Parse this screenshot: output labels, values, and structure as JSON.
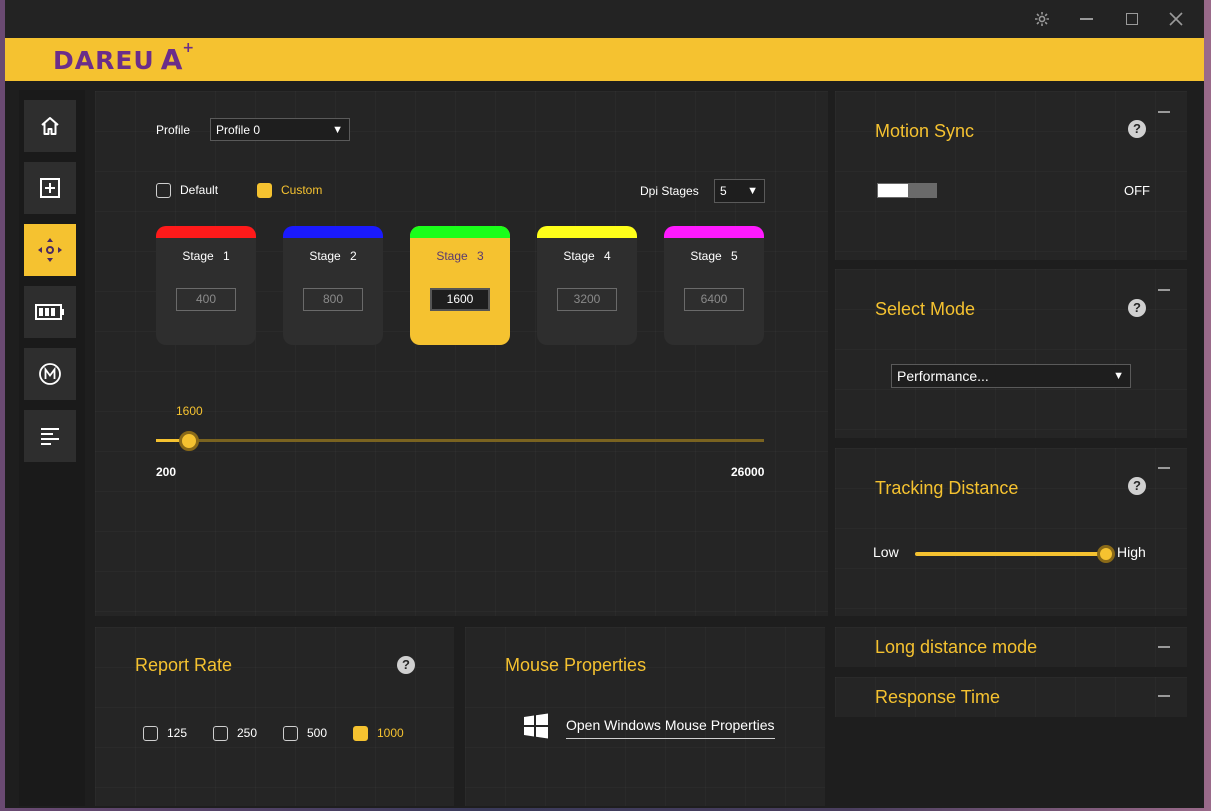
{
  "colors": {
    "accent": "#f5c230",
    "brand_purple": "#6b2d8a",
    "stage_colors": [
      "#ff1a1a",
      "#1a1aff",
      "#1aff1a",
      "#ffff1a",
      "#ff1aff"
    ]
  },
  "brand": {
    "logo_text": "DAREU",
    "logo_mark": "A",
    "logo_plus": "+"
  },
  "window": {
    "settings_icon": "gear-icon",
    "minimize_icon": "minimize-icon",
    "maximize_icon": "maximize-icon",
    "close_icon": "close-icon"
  },
  "sidebar": {
    "items": [
      {
        "icon": "home-icon",
        "active": false
      },
      {
        "icon": "add-icon",
        "active": false
      },
      {
        "icon": "dpi-move-icon",
        "active": true
      },
      {
        "icon": "battery-icon",
        "active": false
      },
      {
        "icon": "macro-icon",
        "active": false
      },
      {
        "icon": "menu-lines-icon",
        "active": false
      }
    ]
  },
  "dpi": {
    "profile_label": "Profile",
    "profile_value": "Profile 0",
    "default_label": "Default",
    "custom_label": "Custom",
    "custom_selected": true,
    "stages_label": "Dpi Stages",
    "stages_value": "5",
    "stages": [
      {
        "name": "Stage  1",
        "value": "400"
      },
      {
        "name": "Stage  2",
        "value": "800"
      },
      {
        "name": "Stage  3",
        "value": "1600"
      },
      {
        "name": "Stage  4",
        "value": "3200"
      },
      {
        "name": "Stage  5",
        "value": "6400"
      }
    ],
    "active_stage": 2,
    "slider_current": "1600",
    "slider_min": "200",
    "slider_max": "26000",
    "slider_value": 1600
  },
  "report_rate": {
    "title": "Report Rate",
    "help": "?",
    "options": [
      "125",
      "250",
      "500",
      "1000"
    ],
    "selected": "1000"
  },
  "mouse_properties": {
    "title": "Mouse Properties",
    "link": "Open Windows Mouse Properties"
  },
  "motion_sync": {
    "title": "Motion Sync",
    "help": "?",
    "state": "OFF"
  },
  "select_mode": {
    "title": "Select Mode",
    "help": "?",
    "value": "Performance..."
  },
  "tracking": {
    "title": "Tracking Distance",
    "help": "?",
    "low": "Low",
    "high": "High",
    "level": 1.0
  },
  "long_distance": {
    "title": "Long distance mode"
  },
  "response_time": {
    "title": "Response Time"
  }
}
